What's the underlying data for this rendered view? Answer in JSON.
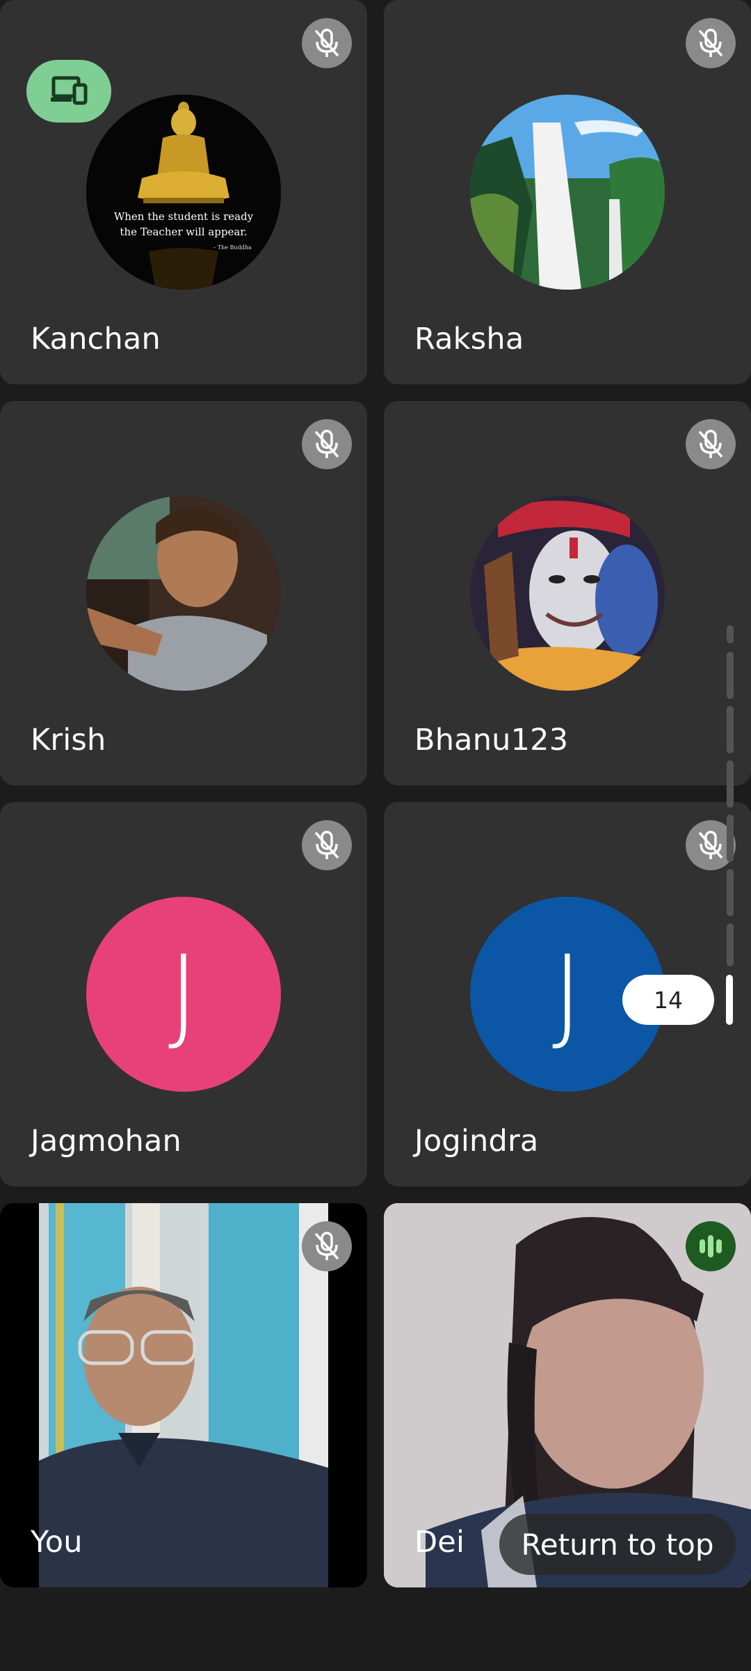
{
  "participants": [
    {
      "name": "Kanchan",
      "muted": true,
      "avatar_type": "photo",
      "avatar_caption_line1": "When the student is ready",
      "avatar_caption_line2": "the Teacher will appear.",
      "avatar_caption_attrib": "– The Buddha"
    },
    {
      "name": "Raksha",
      "muted": true,
      "avatar_type": "photo"
    },
    {
      "name": "Krish",
      "muted": true,
      "avatar_type": "photo"
    },
    {
      "name": "Bhanu123",
      "muted": true,
      "avatar_type": "photo"
    },
    {
      "name": "Jagmohan",
      "muted": true,
      "avatar_type": "letter",
      "initial": "J",
      "color": "#e8417a"
    },
    {
      "name": "Jogindra",
      "muted": true,
      "avatar_type": "letter",
      "initial": "J",
      "color": "#0b57a6"
    },
    {
      "name": "You",
      "muted": true,
      "avatar_type": "video"
    },
    {
      "name": "Dei",
      "muted": false,
      "avatar_type": "video",
      "speaking": true
    }
  ],
  "scroll_indicator": {
    "page_label": "14"
  },
  "return_to_top_label": "Return to top",
  "colors": {
    "background": "#1c1c1d",
    "tile": "#313131",
    "mic_off_bg": "#8a8a8b",
    "device_badge": "#7fcf94",
    "speaking_badge": "#1e5b20"
  },
  "icons": {
    "muted": "mic-off-icon",
    "device": "devices-icon",
    "speaking": "audio-level-icon"
  }
}
